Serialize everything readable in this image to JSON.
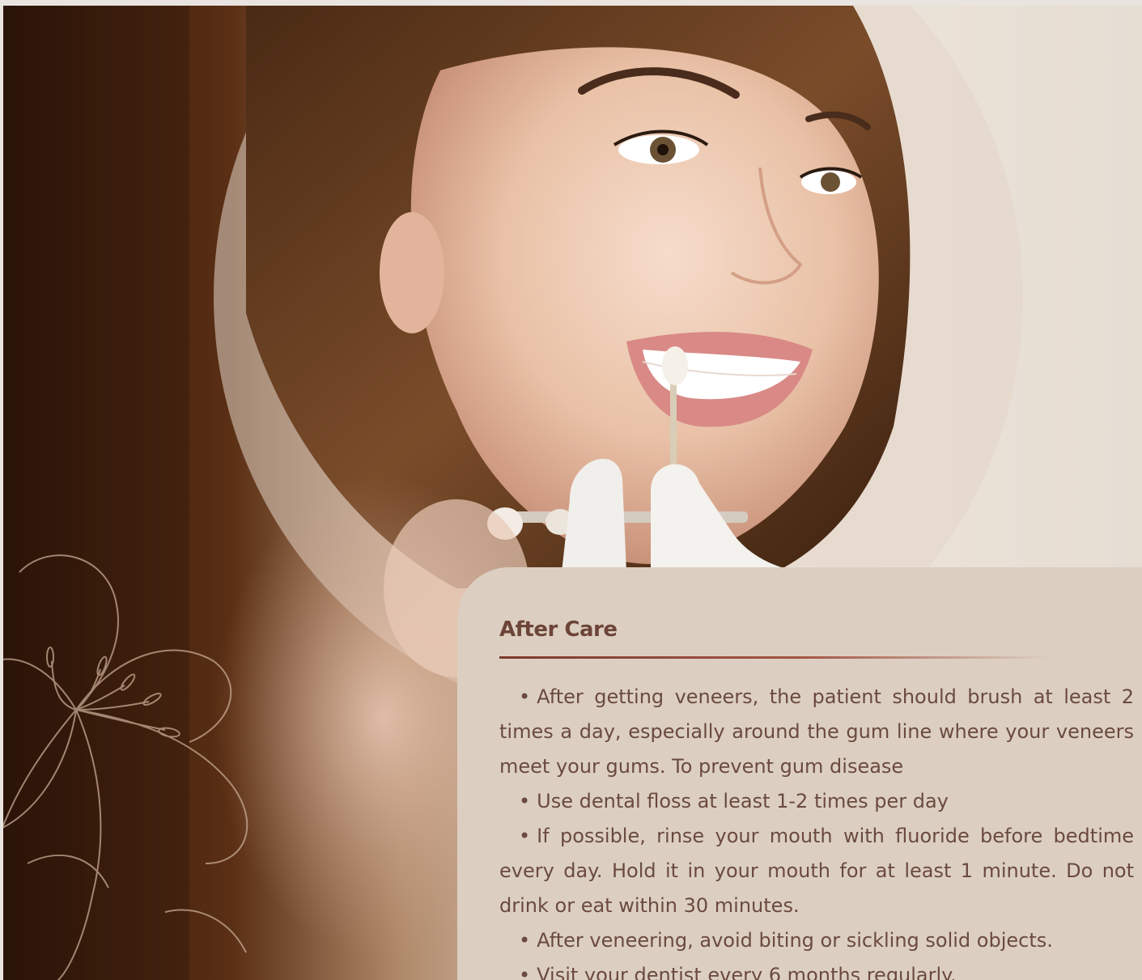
{
  "card": {
    "title": "After Care",
    "bullet": "•",
    "items": [
      {
        "text": "After getting veneers, the patient should brush at least 2  times a day, especially around the gum line where your veneers meet your gums. To prevent gum disease"
      },
      {
        "text": "Use dental floss at least 1-2 times per day"
      },
      {
        "text": "If possible, rinse your mouth with fluoride before bedtime every day. Hold it in your mouth for at least 1 minute. Do not drink or eat within 30 minutes."
      },
      {
        "text": "After veneering, avoid biting or sickling solid objects."
      },
      {
        "text": "Visit your dentist every 6 months regularly."
      }
    ]
  },
  "colors": {
    "card_background": "#dccfc2",
    "title": "#6d4438",
    "body_text": "#6b4a3f",
    "rule": "#7a3a2d",
    "flower_line": "#c7ab94"
  },
  "icons": {
    "decoration": "lily-line-art-icon"
  }
}
